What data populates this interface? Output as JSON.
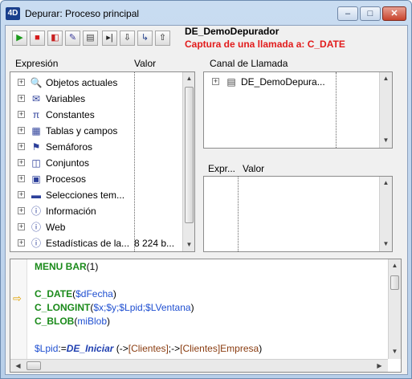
{
  "window": {
    "title": "Depurar: Proceso principal",
    "app_icon_text": "4D",
    "buttons": {
      "minimize": "–",
      "maximize": "□",
      "close": "✕"
    }
  },
  "toolbar": {
    "buttons": [
      {
        "name": "run-button",
        "glyph": "▶",
        "color": "#1c9a1c"
      },
      {
        "name": "abort-button",
        "glyph": "■",
        "color": "#d61c1c"
      },
      {
        "name": "abort-and-edit-button",
        "glyph": "◧",
        "color": "#c82020"
      },
      {
        "name": "edit-button",
        "glyph": "✎",
        "color": "#3a3a9a"
      },
      {
        "name": "save-settings-button",
        "glyph": "▤",
        "color": "#444"
      },
      {
        "name": "step-over-button",
        "glyph": "▸|",
        "color": "#222"
      },
      {
        "name": "step-into-button",
        "glyph": "⇩",
        "color": "#222"
      },
      {
        "name": "step-into-component-button",
        "glyph": "↳",
        "color": "#223f8a"
      },
      {
        "name": "step-out-button",
        "glyph": "⇧",
        "color": "#222"
      }
    ]
  },
  "header": {
    "process_name": "DE_DemoDepurador",
    "capture_text": "Captura de una llamada a: C_DATE"
  },
  "expression_pane": {
    "col_expression": "Expresión",
    "col_value": "Valor",
    "items": [
      {
        "label": "Objetos actuales",
        "icon": "magnifier-icon",
        "glyph": "🔍",
        "value": ""
      },
      {
        "label": "Variables",
        "icon": "envelope-icon",
        "glyph": "✉",
        "value": ""
      },
      {
        "label": "Constantes",
        "icon": "pi-icon",
        "glyph": "π",
        "value": ""
      },
      {
        "label": "Tablas y campos",
        "icon": "table-icon",
        "glyph": "▦",
        "value": ""
      },
      {
        "label": "Semáforos",
        "icon": "semaphore-icon",
        "glyph": "⚑",
        "value": ""
      },
      {
        "label": "Conjuntos",
        "icon": "set-icon",
        "glyph": "◫",
        "value": ""
      },
      {
        "label": "Procesos",
        "icon": "process-icon",
        "glyph": "▣",
        "value": ""
      },
      {
        "label": "Selecciones tem...",
        "icon": "selection-icon",
        "glyph": "▬",
        "value": ""
      },
      {
        "label": "Información",
        "icon": "info-icon",
        "glyph": "ⓘ",
        "value": ""
      },
      {
        "label": "Web",
        "icon": "web-icon",
        "glyph": "ⓘ",
        "value": ""
      },
      {
        "label": "Estadísticas de la...",
        "icon": "stats-icon",
        "glyph": "ⓘ",
        "value": "8 224 b..."
      }
    ]
  },
  "call_chain_pane": {
    "title": "Canal de Llamada",
    "items": [
      {
        "label": "DE_DemoDepura..."
      }
    ]
  },
  "custom_watch_pane": {
    "col_expression": "Expr...",
    "col_value": "Valor"
  },
  "source_pane": {
    "lines": [
      {
        "parts": [
          {
            "t": "MENU BAR",
            "c": "kw"
          },
          {
            "t": "(1)",
            "c": ""
          }
        ]
      },
      {
        "parts": []
      },
      {
        "parts": [
          {
            "t": "C_DATE",
            "c": "kw"
          },
          {
            "t": "(",
            "c": ""
          },
          {
            "t": "$dFecha",
            "c": "var"
          },
          {
            "t": ")",
            "c": ""
          }
        ],
        "current": true
      },
      {
        "parts": [
          {
            "t": "C_LONGINT",
            "c": "kw"
          },
          {
            "t": "(",
            "c": ""
          },
          {
            "t": "$x;$y;$Lpid;$LVentana",
            "c": "var"
          },
          {
            "t": ")",
            "c": ""
          }
        ]
      },
      {
        "parts": [
          {
            "t": "C_BLOB",
            "c": "kw"
          },
          {
            "t": "(",
            "c": ""
          },
          {
            "t": "miBlob",
            "c": "var"
          },
          {
            "t": ")",
            "c": ""
          }
        ]
      },
      {
        "parts": []
      },
      {
        "parts": [
          {
            "t": "$Lpid",
            "c": "var"
          },
          {
            "t": ":=",
            "c": ""
          },
          {
            "t": "DE_Iniciar",
            "c": "fn"
          },
          {
            "t": " (->",
            "c": ""
          },
          {
            "t": "[Clientes]",
            "c": "tbl"
          },
          {
            "t": ";->",
            "c": ""
          },
          {
            "t": "[Clientes]Empresa",
            "c": "tbl"
          },
          {
            "t": ")",
            "c": ""
          }
        ]
      }
    ],
    "program_counter_glyph": "⇨"
  }
}
